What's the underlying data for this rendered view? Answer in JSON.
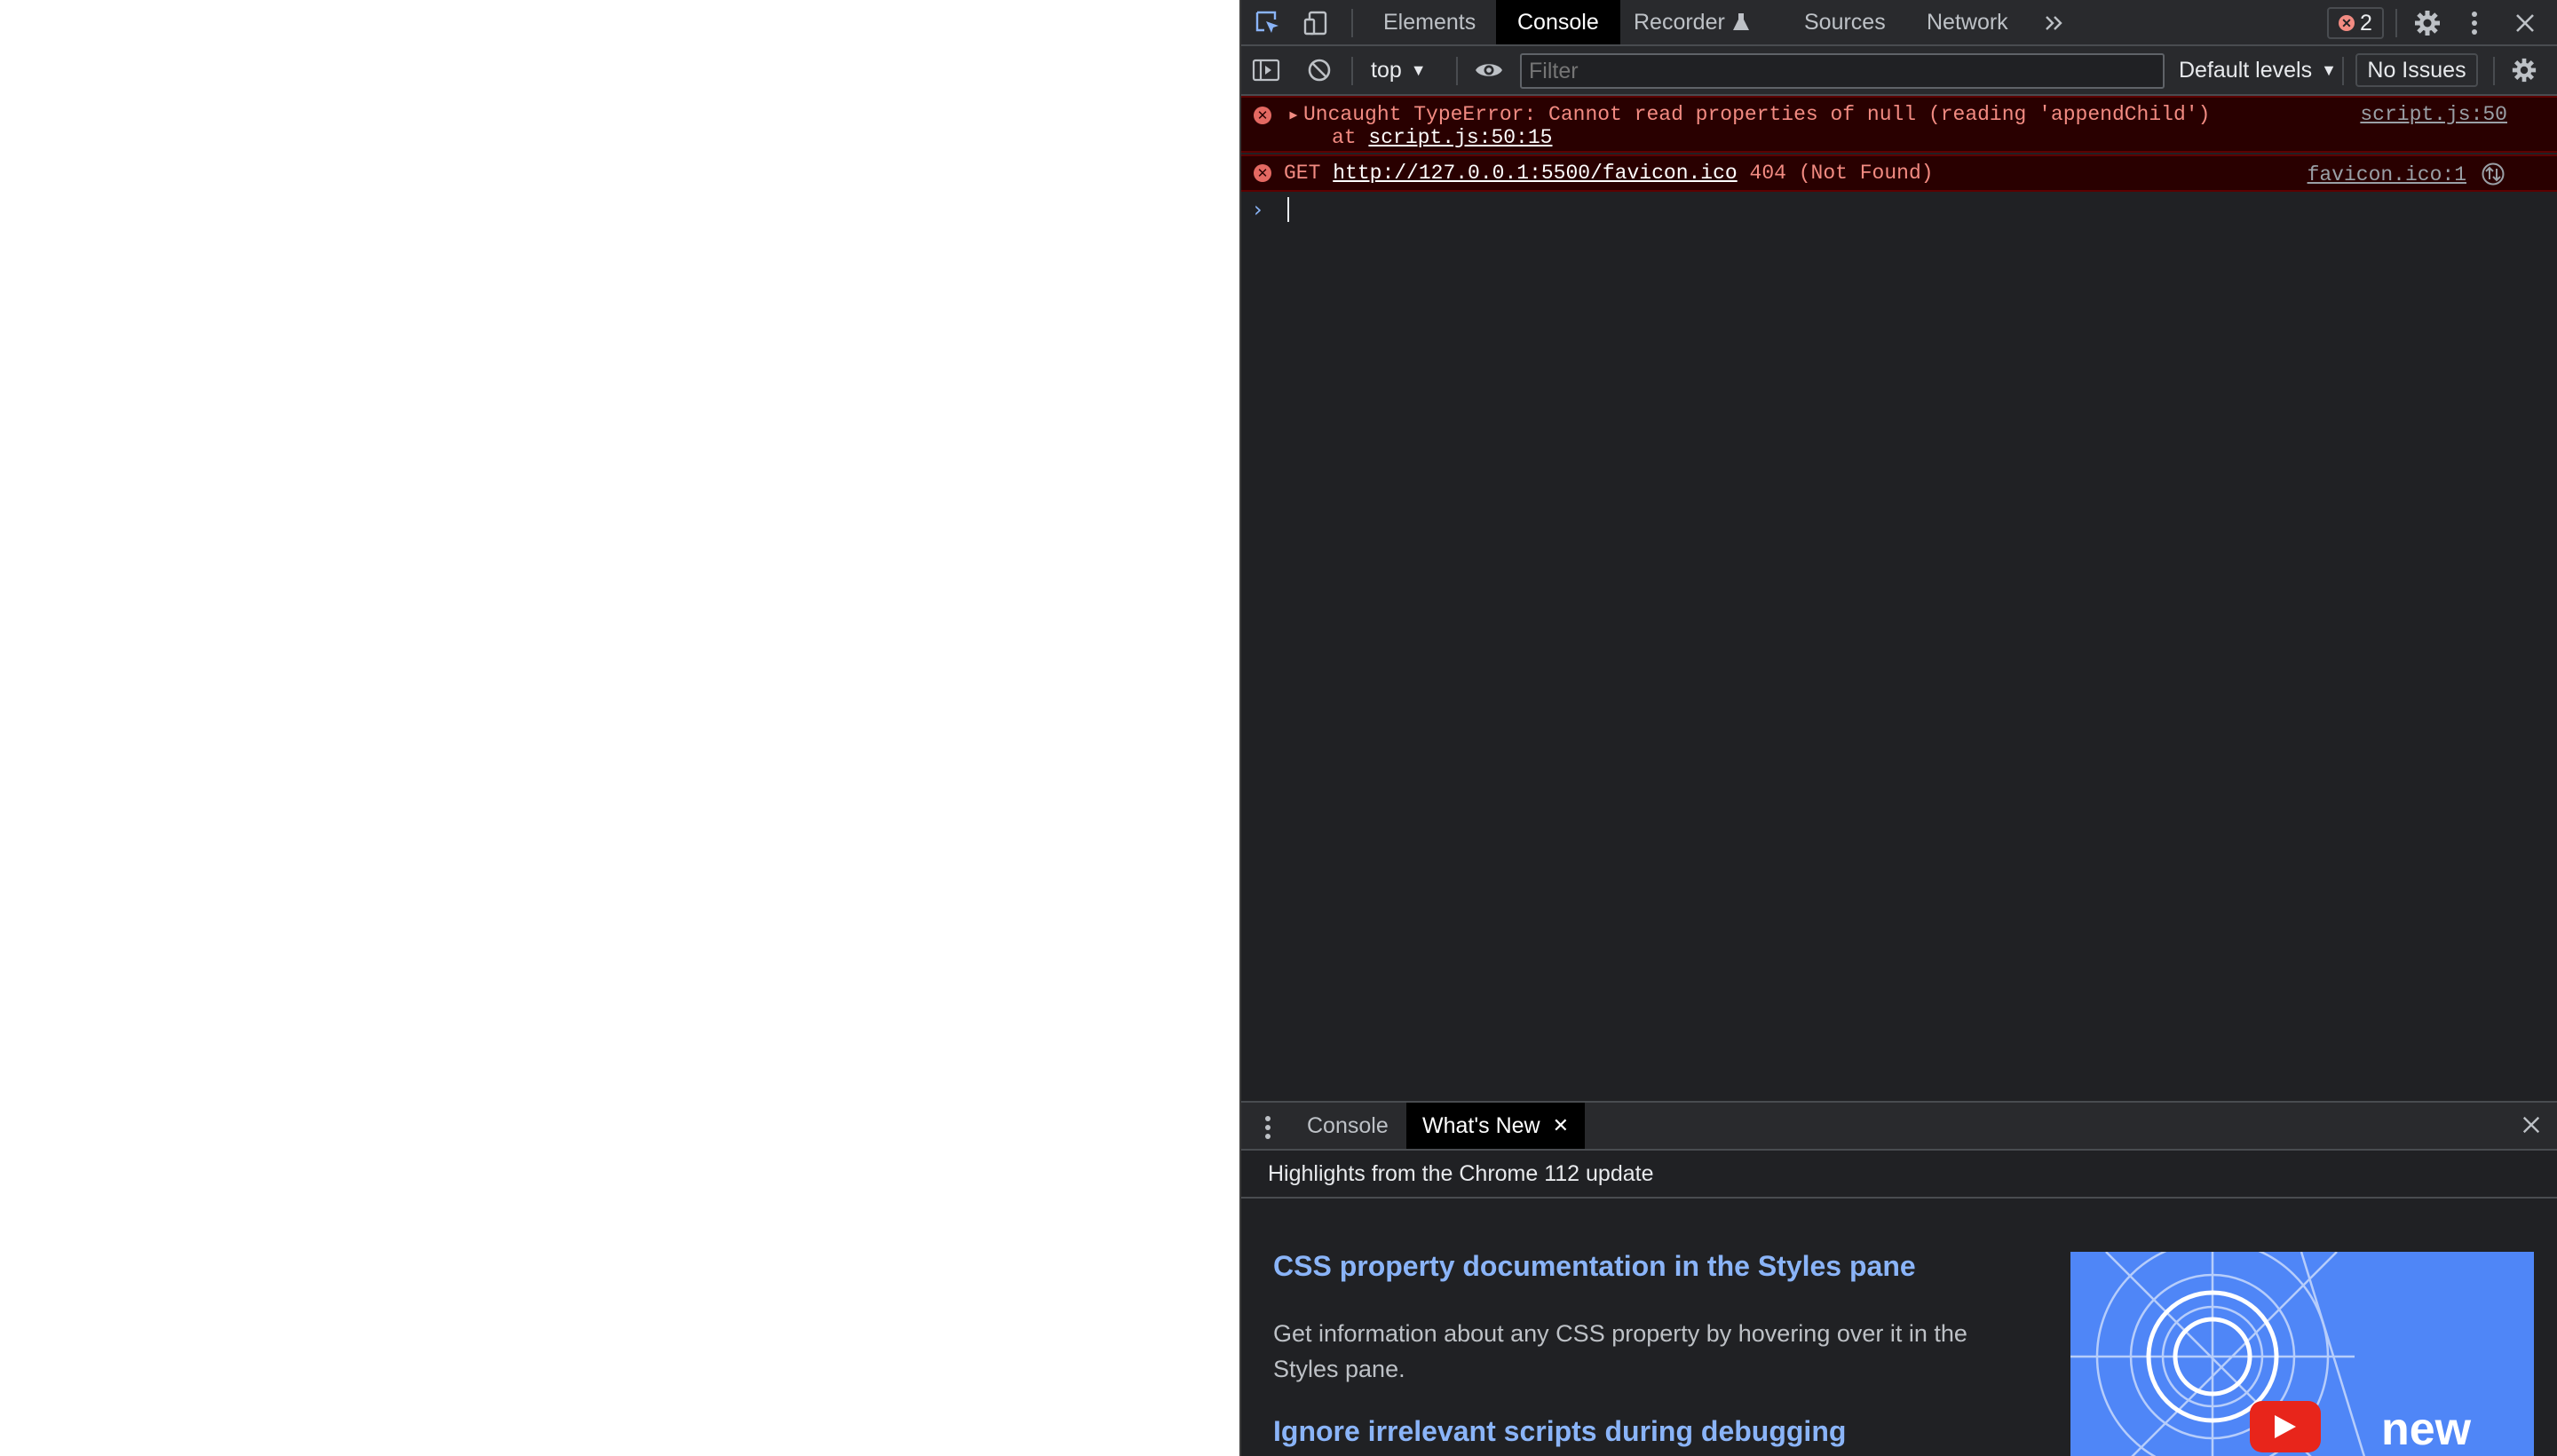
{
  "toolbar": {
    "tabs": [
      {
        "label": "Elements",
        "active": false
      },
      {
        "label": "Console",
        "active": true
      },
      {
        "label": "Recorder",
        "active": false
      },
      {
        "label": "Sources",
        "active": false
      },
      {
        "label": "Network",
        "active": false
      }
    ],
    "error_count": "2",
    "icons": [
      "inspect-element-icon",
      "device-toolbar-icon",
      "recorder-flask-icon",
      "more-tabs-icon",
      "error-icon",
      "gear-icon",
      "kebab-menu-icon",
      "close-icon"
    ]
  },
  "console_toolbar": {
    "context": "top",
    "filter_placeholder": "Filter",
    "levels": "Default levels",
    "issues": "No Issues",
    "icons": [
      "sidebar-toggle-icon",
      "clear-console-icon",
      "live-expression-eye-icon",
      "gear-icon"
    ]
  },
  "messages": [
    {
      "level": "error",
      "text": "Uncaught TypeError: Cannot read properties of null (reading 'appendChild')",
      "stack_prefix": "at ",
      "stack_link": "script.js:50:15",
      "source": "script.js:50"
    },
    {
      "level": "error",
      "method": "GET",
      "url": "http://127.0.0.1:5500/favicon.ico",
      "status": "404 (Not Found)",
      "source": "favicon.ico:1"
    }
  ],
  "drawer": {
    "tabs": [
      {
        "label": "Console",
        "active": false
      },
      {
        "label": "What's New",
        "active": true
      }
    ],
    "header": "Highlights from the Chrome 112 update",
    "items": [
      {
        "title": "CSS property documentation in the Styles pane",
        "description": "Get information about any CSS property by hovering over it in the Styles pane."
      },
      {
        "title": "Ignore irrelevant scripts during debugging",
        "description": ""
      }
    ],
    "thumbnail_text": "new"
  },
  "colors": {
    "panel_bg": "#202124",
    "toolbar_bg": "#292a2d",
    "error_text": "#f28b82",
    "error_bg": "#290000",
    "link_blue": "#8ab4f8",
    "thumbnail_blue": "#4f86f7"
  }
}
